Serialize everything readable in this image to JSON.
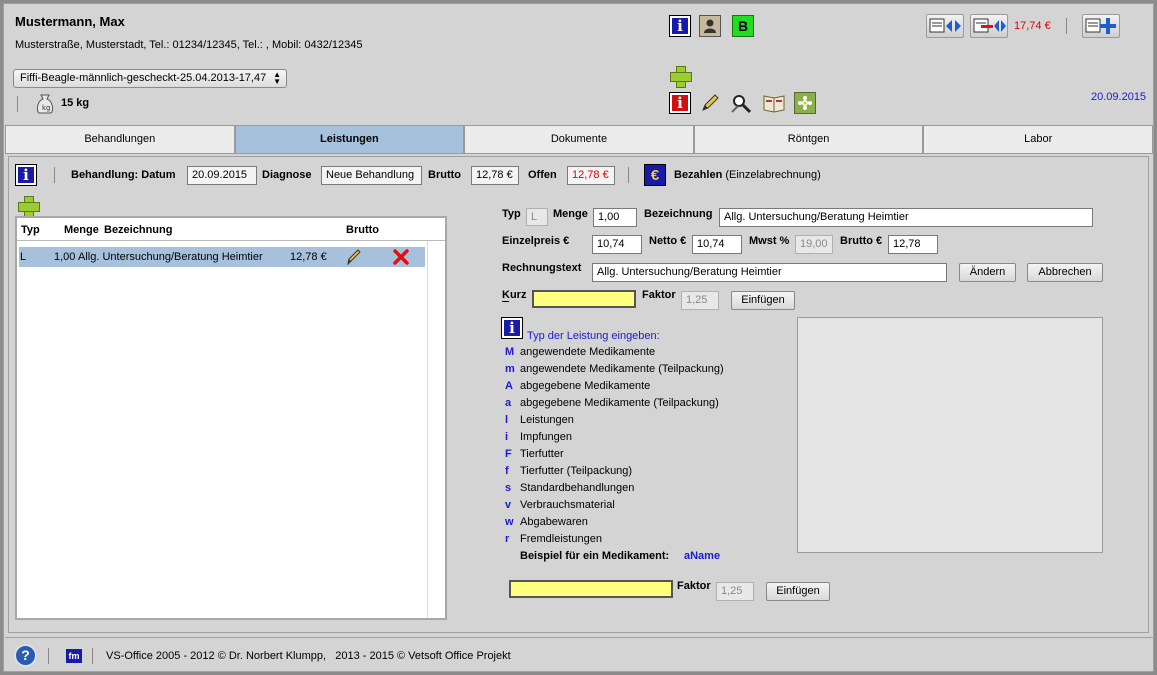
{
  "patient": {
    "name": "Mustermann, Max",
    "address": "Musterstraße, Musterstadt, Tel.: 01234/12345, Tel.: , Mobil: 0432/12345",
    "animal_select": "Fiffi-Beagle-männlich-gescheckt-25.04.2013-17,47",
    "weight": "15 kg",
    "badge_letter": "B"
  },
  "header": {
    "balance": "17,74 €",
    "date": "20.09.2015"
  },
  "tabs": [
    "Behandlungen",
    "Leistungen",
    "Dokumente",
    "Röntgen",
    "Labor"
  ],
  "active_tab": "Leistungen",
  "treatment_bar": {
    "date_label": "Behandlung: Datum",
    "date_value": "20.09.2015",
    "diagnose_label": "Diagnose",
    "diagnose_value": "Neue Behandlung",
    "brutto_label": "Brutto",
    "brutto_value": "12,78 €",
    "offen_label": "Offen",
    "offen_value": "12,78 €",
    "pay_label": "Bezahlen",
    "pay_sub": "(Einzelabrechnung)",
    "euro_symbol": "€"
  },
  "list": {
    "headers": {
      "typ": "Typ",
      "menge": "Menge",
      "bezeichnung": "Bezeichnung",
      "brutto": "Brutto"
    },
    "rows": [
      {
        "typ": "L",
        "menge": "1,00",
        "bezeichnung": "Allg. Untersuchung/Beratung Heimtier",
        "brutto": "12,78 €"
      }
    ]
  },
  "form": {
    "typ_label": "Typ",
    "typ_value": "L",
    "menge_label": "Menge",
    "menge_value": "1,00",
    "bez_label": "Bezeichnung",
    "bez_value": "Allg. Untersuchung/Beratung Heimtier",
    "einzelpreis_label": "Einzelpreis €",
    "einzelpreis_value": "10,74",
    "netto_label": "Netto €",
    "netto_value": "10,74",
    "mwst_label": "Mwst %",
    "mwst_value": "19,00",
    "brutto_label": "Brutto €",
    "brutto_value": "12,78",
    "rechnungstext_label": "Rechnungstext",
    "rechnungstext_value": "Allg. Untersuchung/Beratung Heimtier",
    "aendern": "Ändern",
    "abbrechen": "Abbrechen",
    "kurz_label": "Kurz",
    "kurz_value": "",
    "faktor_label": "Faktor",
    "faktor_value": "1,25",
    "einfuegen": "Einfügen"
  },
  "help": {
    "title": "Typ der Leistung eingeben:",
    "items": [
      {
        "code": "M",
        "label": "angewendete Medikamente"
      },
      {
        "code": "m",
        "label": "angewendete Medikamente (Teilpackung)"
      },
      {
        "code": "A",
        "label": "abgegebene Medikamente"
      },
      {
        "code": "a",
        "label": "abgegebene Medikamente (Teilpackung)"
      },
      {
        "code": "l",
        "label": "Leistungen"
      },
      {
        "code": "i",
        "label": "Impfungen"
      },
      {
        "code": "F",
        "label": "Tierfutter"
      },
      {
        "code": "f",
        "label": "Tierfutter (Teilpackung)"
      },
      {
        "code": "s",
        "label": "Standardbehandlungen"
      },
      {
        "code": "v",
        "label": "Verbrauchsmaterial"
      },
      {
        "code": "w",
        "label": "Abgabewaren"
      },
      {
        "code": "r",
        "label": "Fremdleistungen"
      }
    ],
    "example_label": "Beispiel für ein Medikament:",
    "example_value": "aName"
  },
  "bottom": {
    "input_value": "",
    "faktor_label": "Faktor",
    "faktor_value": "1,25",
    "einfuegen": "Einfügen"
  },
  "footer": {
    "help_symbol": "?",
    "fm_label": "fm",
    "copyright": "VS-Office 2005 - 2012 © Dr. Norbert Klumpp,   2013 - 2015 © Vetsoft Office Projekt"
  },
  "colors": {
    "accent_tab": "#a7c1dd",
    "info_blue": "#1a1aa8",
    "help_blue": "#1a1ad0",
    "red_amount": "#e00000"
  }
}
